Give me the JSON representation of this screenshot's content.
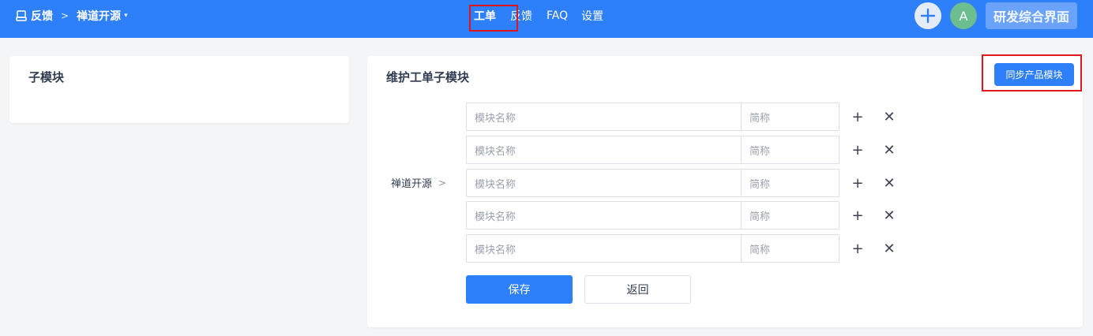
{
  "header": {
    "breadcrumb": {
      "root_label": "反馈",
      "separator": ">",
      "product_label": "禅道开源",
      "product_caret": "▾"
    },
    "nav": {
      "items": [
        {
          "label": "工单",
          "active": true
        },
        {
          "label": "反馈",
          "active": false
        },
        {
          "label": "FAQ",
          "active": false
        },
        {
          "label": "设置",
          "active": false
        }
      ]
    },
    "avatar_initial": "A",
    "workspace_label": "研发综合界面"
  },
  "left_panel": {
    "title": "子模块"
  },
  "main_panel": {
    "title": "维护工单子模块",
    "sync_button_label": "同步产品模块",
    "product_label": "禅道开源",
    "product_arrow": ">",
    "rows": [
      {
        "name_placeholder": "模块名称",
        "abbr_placeholder": "简称"
      },
      {
        "name_placeholder": "模块名称",
        "abbr_placeholder": "简称"
      },
      {
        "name_placeholder": "模块名称",
        "abbr_placeholder": "简称"
      },
      {
        "name_placeholder": "模块名称",
        "abbr_placeholder": "简称"
      },
      {
        "name_placeholder": "模块名称",
        "abbr_placeholder": "简称"
      }
    ],
    "add_icon": "+",
    "remove_icon": "✕",
    "save_label": "保存",
    "back_label": "返回"
  },
  "colors": {
    "primary": "#2e7ffa",
    "highlight": "#e0161c",
    "avatar": "#6cbd8f"
  }
}
